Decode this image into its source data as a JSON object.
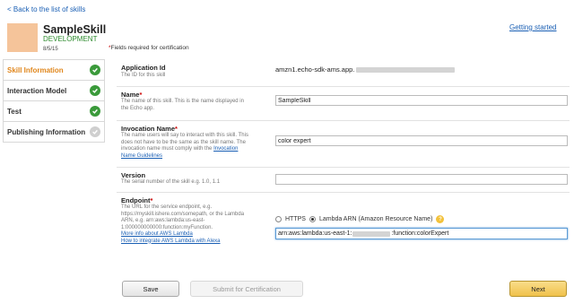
{
  "header": {
    "back_link": "< Back to the list of skills",
    "getting_started": "Getting started",
    "required_note_star": "*",
    "required_note": "Fields required for certification"
  },
  "skill": {
    "name": "SampleSkill",
    "stage": "DEVELOPMENT",
    "date": "8/5/15",
    "icon_color": "#f5c49a"
  },
  "sidebar": {
    "items": [
      {
        "label": "Skill Information",
        "status": "complete",
        "active": true
      },
      {
        "label": "Interaction Model",
        "status": "complete",
        "active": false
      },
      {
        "label": "Test",
        "status": "complete",
        "active": false
      },
      {
        "label": "Publishing Information",
        "status": "incomplete",
        "active": false
      }
    ]
  },
  "form": {
    "app_id": {
      "label": "Application Id",
      "desc": "The ID for this skill",
      "value_prefix": "amzn1.echo-sdk-ams.app."
    },
    "name": {
      "label": "Name",
      "star": "*",
      "desc": "The name of this skill. This is the name displayed in the Echo app.",
      "value": "SampleSkill"
    },
    "invocation": {
      "label": "Invocation Name",
      "star": "*",
      "desc": "The name users will say to interact with this skill. This does not have to be the same as the skill name. The invocation name must comply with the",
      "desc_link": "Invocation Name Guidelines",
      "value": "color expert"
    },
    "version": {
      "label": "Version",
      "desc": "The serial number of the skill e.g. 1.0, 1.1",
      "value": ""
    },
    "endpoint": {
      "label": "Endpoint",
      "star": "*",
      "desc": "The URL for the service endpoint, e.g. https://myskill.ishere.com/somepath, or the Lambda ARN, e.g. arn:aws:lambda:us-east-1:000000000000:function:myFunction.",
      "link1": "More info about AWS Lambda",
      "link2": "How to integrate AWS Lambda with Alexa",
      "option_https": "HTTPS",
      "option_lambda": "Lambda ARN (Amazon Resource Name)",
      "selected": "lambda",
      "value_prefix": "arn:aws:lambda:us-east-1:",
      "value_suffix": ":function:colorExpert"
    }
  },
  "buttons": {
    "save": "Save",
    "submit": "Submit for Certification",
    "next": "Next"
  },
  "colors": {
    "accent_orange": "#e0861b",
    "check_green": "#3a9a3a",
    "link_blue": "#1a5fb4",
    "next_button": "#f0c14b"
  }
}
